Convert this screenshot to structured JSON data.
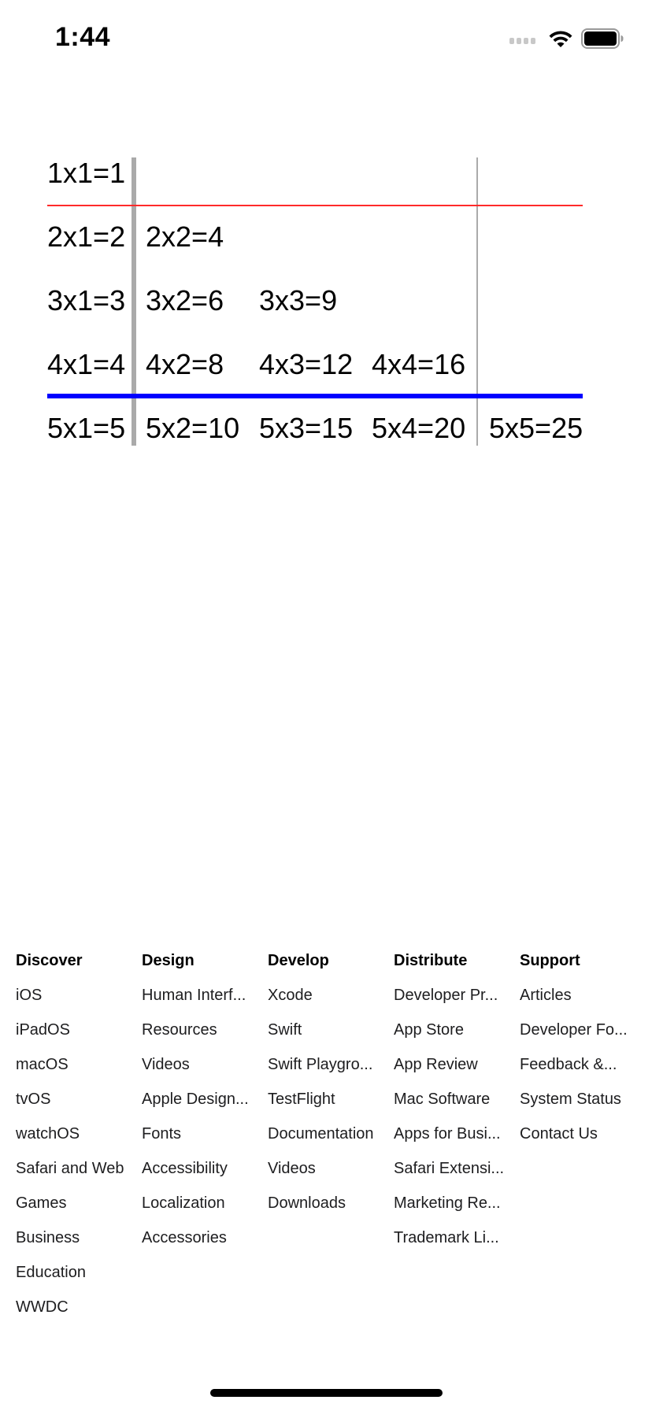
{
  "status_bar": {
    "time": "1:44",
    "icons": [
      "cellular-signal-icon",
      "wifi-icon",
      "battery-icon"
    ]
  },
  "table": {
    "rows": [
      [
        "1x1=1"
      ],
      [
        "2x1=2",
        "2x2=4"
      ],
      [
        "3x1=3",
        "3x2=6",
        "3x3=9"
      ],
      [
        "4x1=4",
        "4x2=8",
        "4x3=12",
        "4x4=16"
      ],
      [
        "5x1=5",
        "5x2=10",
        "5x3=15",
        "5x4=20",
        "5x5=25"
      ]
    ],
    "colors": {
      "thick_divider": "#aaaaaa",
      "thin_divider": "#aaaaaa",
      "red_rule": "#ff2a2a",
      "blue_rule": "#0000ff"
    }
  },
  "footer": {
    "columns": [
      {
        "title": "Discover",
        "links": [
          "iOS",
          "iPadOS",
          "macOS",
          "tvOS",
          "watchOS",
          "Safari and Web",
          "Games",
          "Business",
          "Education",
          "WWDC"
        ]
      },
      {
        "title": "Design",
        "links": [
          "Human Interf...",
          "Resources",
          "Videos",
          "Apple Design...",
          "Fonts",
          "Accessibility",
          "Localization",
          "Accessories"
        ]
      },
      {
        "title": "Develop",
        "links": [
          "Xcode",
          "Swift",
          "Swift Playgro...",
          "TestFlight",
          "Documentation",
          "Videos",
          "Downloads"
        ]
      },
      {
        "title": "Distribute",
        "links": [
          "Developer Pr...",
          "App Store",
          "App Review",
          "Mac Software",
          "Apps for Busi...",
          "Safari Extensi...",
          "Marketing Re...",
          "Trademark Li..."
        ]
      },
      {
        "title": "Support",
        "links": [
          "Articles",
          "Developer Fo...",
          "Feedback &...",
          "System Status",
          "Contact Us"
        ]
      }
    ]
  }
}
